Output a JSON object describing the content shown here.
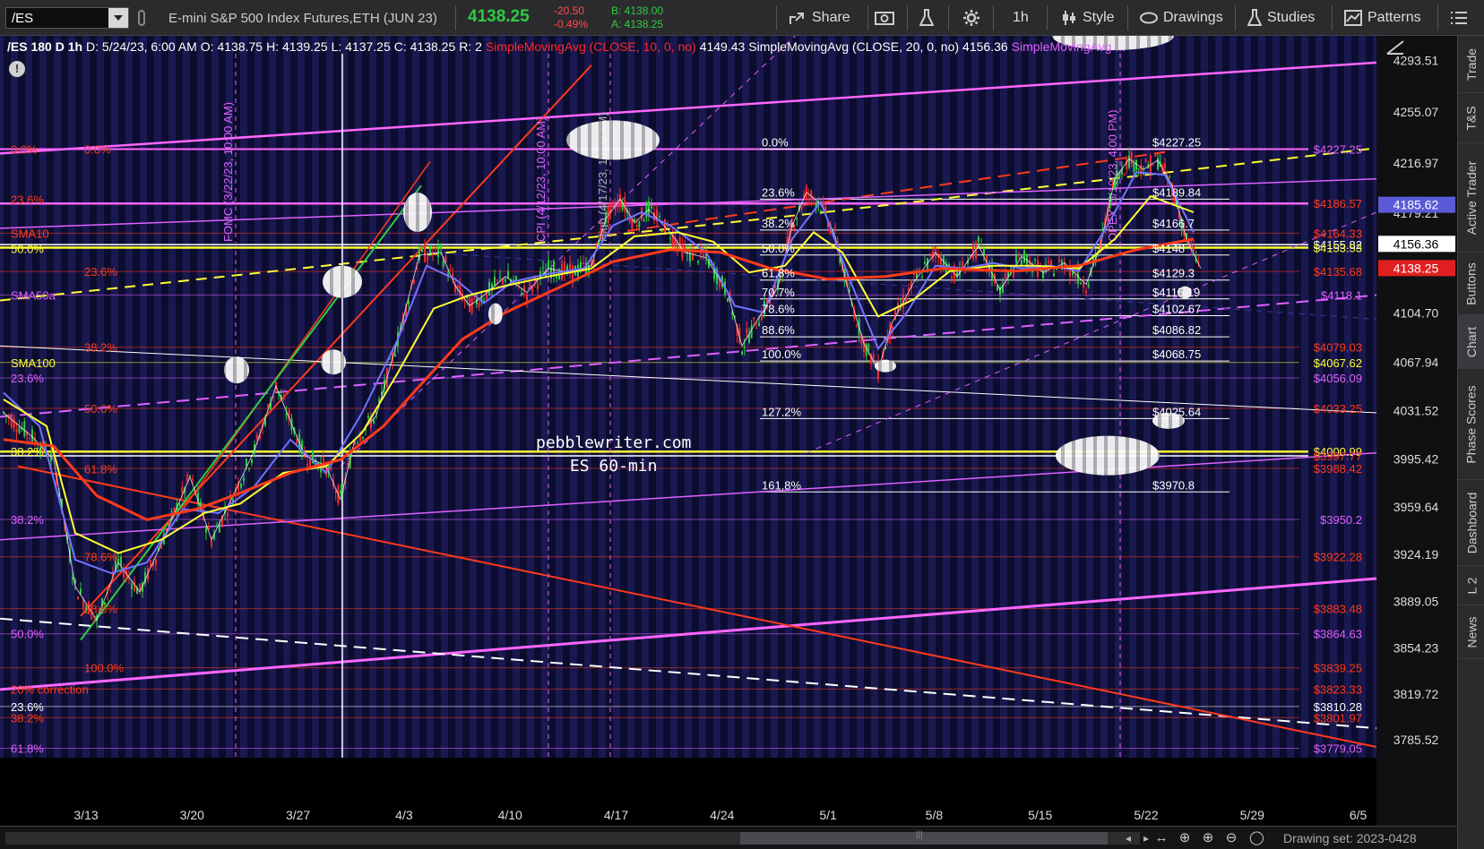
{
  "toolbar": {
    "symbol": "/ES",
    "instrument": "E-mini S&P 500 Index Futures,ETH (JUN 23)",
    "last": "4138.25",
    "net_change": "-20.50",
    "pct_change": "-0.49%",
    "bid": "B: 4138.00",
    "ask": "A: 4138.25",
    "share": "Share",
    "interval": "1h",
    "style": "Style",
    "drawings": "Drawings",
    "studies": "Studies",
    "patterns": "Patterns"
  },
  "stats_bar": {
    "symbol": "/ES 180 D 1h",
    "date": "D: 5/24/23, 6:00 AM",
    "open": "O: 4138.75",
    "high": "H: 4139.25",
    "low": "L: 4137.25",
    "close": "C: 4138.25",
    "range": "R: 2",
    "sma10_label": "SimpleMovingAvg (CLOSE, 10, 0, no)",
    "sma10_value": "4149.43",
    "sma20_label": "SimpleMovingAvg (CLOSE, 20, 0, no)",
    "sma20_value": "4156.36",
    "sma_more": "SimpleMovingAvg ..."
  },
  "right_tabs": [
    "Trade",
    "T&S",
    "Active Trader",
    "Buttons",
    "Chart",
    "Phase Scores",
    "Dashboard",
    "L 2",
    "News"
  ],
  "active_tab": "Chart",
  "bottom_bar": {
    "drawing_set": "Drawing set: 2023-0428"
  },
  "watermark": {
    "line1": "pebblewriter.com",
    "line2": "ES 60-min"
  },
  "chart_data": {
    "type": "candlestick",
    "x_ticks": [
      "3/13",
      "3/20",
      "3/27",
      "4/3",
      "4/10",
      "4/17",
      "4/24",
      "5/1",
      "5/8",
      "5/15",
      "5/22",
      "5/29",
      "6/5"
    ],
    "y_ticks": [
      4293.51,
      4255.07,
      4216.97,
      4179.21,
      4104.7,
      4067.94,
      4031.52,
      3995.42,
      3959.64,
      3924.19,
      3889.05,
      3854.23,
      3819.72,
      3785.52
    ],
    "ylim": [
      3772,
      4312
    ],
    "price_badges": [
      {
        "value": "4185.62",
        "color": "#5b5bd8"
      },
      {
        "value": "4156.36",
        "color": "#ffffff"
      },
      {
        "value": "4138.25",
        "color": "#e02020"
      }
    ],
    "series": [
      {
        "name": "SMA10",
        "color": "#6f73ff"
      },
      {
        "name": "SMA20",
        "color": "#ffff33"
      },
      {
        "name": "SMA50a",
        "color": "#ff3a1a"
      },
      {
        "name": "SMA100",
        "color": "#ff3a1a"
      }
    ],
    "price_path": [
      [
        0,
        4030
      ],
      [
        8,
        4012
      ],
      [
        14,
        3995
      ],
      [
        20,
        3900
      ],
      [
        26,
        3875
      ],
      [
        32,
        3918
      ],
      [
        38,
        3896
      ],
      [
        44,
        3932
      ],
      [
        52,
        3982
      ],
      [
        58,
        3935
      ],
      [
        64,
        3968
      ],
      [
        70,
        4002
      ],
      [
        76,
        4050
      ],
      [
        84,
        3998
      ],
      [
        90,
        3990
      ],
      [
        94,
        3965
      ],
      [
        98,
        4010
      ],
      [
        104,
        4028
      ],
      [
        110,
        4085
      ],
      [
        116,
        4148
      ],
      [
        122,
        4150
      ],
      [
        126,
        4125
      ],
      [
        130,
        4110
      ],
      [
        134,
        4118
      ],
      [
        140,
        4132
      ],
      [
        146,
        4120
      ],
      [
        152,
        4138
      ],
      [
        158,
        4135
      ],
      [
        164,
        4140
      ],
      [
        168,
        4175
      ],
      [
        172,
        4190
      ],
      [
        176,
        4172
      ],
      [
        180,
        4182
      ],
      [
        186,
        4165
      ],
      [
        190,
        4150
      ],
      [
        196,
        4146
      ],
      [
        202,
        4120
      ],
      [
        206,
        4080
      ],
      [
        210,
        4098
      ],
      [
        216,
        4124
      ],
      [
        220,
        4170
      ],
      [
        224,
        4195
      ],
      [
        228,
        4186
      ],
      [
        232,
        4162
      ],
      [
        236,
        4118
      ],
      [
        240,
        4082
      ],
      [
        244,
        4062
      ],
      [
        248,
        4098
      ],
      [
        254,
        4128
      ],
      [
        260,
        4150
      ],
      [
        266,
        4132
      ],
      [
        272,
        4155
      ],
      [
        278,
        4122
      ],
      [
        284,
        4147
      ],
      [
        290,
        4135
      ],
      [
        296,
        4142
      ],
      [
        302,
        4126
      ],
      [
        306,
        4155
      ],
      [
        310,
        4205
      ],
      [
        314,
        4220
      ],
      [
        318,
        4212
      ],
      [
        322,
        4219
      ],
      [
        326,
        4200
      ],
      [
        330,
        4160
      ],
      [
        334,
        4138
      ]
    ],
    "sma_fast_path": [
      [
        0,
        4045
      ],
      [
        10,
        4020
      ],
      [
        20,
        3920
      ],
      [
        30,
        3910
      ],
      [
        40,
        3918
      ],
      [
        50,
        3958
      ],
      [
        60,
        3955
      ],
      [
        70,
        3975
      ],
      [
        80,
        4010
      ],
      [
        90,
        3985
      ],
      [
        100,
        4030
      ],
      [
        110,
        4085
      ],
      [
        118,
        4140
      ],
      [
        126,
        4130
      ],
      [
        134,
        4112
      ],
      [
        142,
        4128
      ],
      [
        152,
        4134
      ],
      [
        162,
        4138
      ],
      [
        170,
        4170
      ],
      [
        178,
        4180
      ],
      [
        186,
        4170
      ],
      [
        196,
        4150
      ],
      [
        204,
        4110
      ],
      [
        212,
        4105
      ],
      [
        220,
        4160
      ],
      [
        228,
        4188
      ],
      [
        236,
        4130
      ],
      [
        244,
        4078
      ],
      [
        252,
        4105
      ],
      [
        260,
        4140
      ],
      [
        268,
        4138
      ],
      [
        276,
        4142
      ],
      [
        284,
        4138
      ],
      [
        292,
        4140
      ],
      [
        300,
        4136
      ],
      [
        308,
        4170
      ],
      [
        316,
        4210
      ],
      [
        324,
        4208
      ],
      [
        332,
        4165
      ]
    ],
    "sma_slow_path": [
      [
        0,
        4040
      ],
      [
        12,
        4020
      ],
      [
        20,
        3940
      ],
      [
        32,
        3925
      ],
      [
        44,
        3935
      ],
      [
        56,
        3955
      ],
      [
        66,
        3962
      ],
      [
        78,
        3985
      ],
      [
        90,
        3990
      ],
      [
        100,
        4015
      ],
      [
        110,
        4060
      ],
      [
        120,
        4108
      ],
      [
        130,
        4118
      ],
      [
        140,
        4125
      ],
      [
        152,
        4132
      ],
      [
        164,
        4138
      ],
      [
        176,
        4162
      ],
      [
        188,
        4165
      ],
      [
        198,
        4158
      ],
      [
        208,
        4135
      ],
      [
        218,
        4140
      ],
      [
        226,
        4165
      ],
      [
        234,
        4150
      ],
      [
        244,
        4102
      ],
      [
        254,
        4115
      ],
      [
        264,
        4136
      ],
      [
        276,
        4140
      ],
      [
        288,
        4140
      ],
      [
        300,
        4138
      ],
      [
        310,
        4160
      ],
      [
        320,
        4192
      ],
      [
        332,
        4180
      ]
    ],
    "sma50_path": [
      [
        0,
        4010
      ],
      [
        14,
        4005
      ],
      [
        26,
        3968
      ],
      [
        40,
        3950
      ],
      [
        54,
        3958
      ],
      [
        66,
        3970
      ],
      [
        80,
        3985
      ],
      [
        94,
        3995
      ],
      [
        106,
        4020
      ],
      [
        116,
        4050
      ],
      [
        128,
        4085
      ],
      [
        140,
        4105
      ],
      [
        156,
        4125
      ],
      [
        170,
        4143
      ],
      [
        186,
        4152
      ],
      [
        200,
        4150
      ],
      [
        214,
        4138
      ],
      [
        230,
        4130
      ],
      [
        246,
        4132
      ],
      [
        262,
        4138
      ],
      [
        282,
        4136
      ],
      [
        300,
        4140
      ],
      [
        316,
        4152
      ],
      [
        332,
        4160
      ]
    ],
    "fib_left_labels": [
      {
        "text": "0.0%",
        "price": 4227.25,
        "color": "#ff3a1a",
        "x": 12
      },
      {
        "text": "0.0%",
        "price": 4227.25,
        "color": "#ff3a1a",
        "x": 94
      },
      {
        "text": "23.6%",
        "price": 4189.84,
        "color": "#ff3a1a",
        "x": 12
      },
      {
        "text": "SMA10",
        "price": 4164.33,
        "color": "#ff3a1a",
        "x": 12
      },
      {
        "text": "50.0%",
        "price": 4152.9,
        "color": "#ffff33",
        "x": 12
      },
      {
        "text": "23.6%",
        "price": 4135.68,
        "color": "#ff3a1a",
        "x": 94
      },
      {
        "text": "SMA50a",
        "price": 4118.1,
        "color": "#e060ff",
        "x": 12
      },
      {
        "text": "38.2%",
        "price": 4079.03,
        "color": "#ff3a1a",
        "x": 94
      },
      {
        "text": "SMA100",
        "price": 4067.62,
        "color": "#ffff33",
        "x": 12
      },
      {
        "text": "23.6%",
        "price": 4056.09,
        "color": "#e060ff",
        "x": 12
      },
      {
        "text": "50.0%",
        "price": 4033.25,
        "color": "#ff3a1a",
        "x": 94
      },
      {
        "text": "38.2%",
        "price": 4000.99,
        "color": "#ffff33",
        "x": 12
      },
      {
        "text": "61.8%",
        "price": 3988.0,
        "color": "#ff3a1a",
        "x": 94
      },
      {
        "text": "38.2%",
        "price": 3950.2,
        "color": "#e060ff",
        "x": 12
      },
      {
        "text": "78.6%",
        "price": 3922.28,
        "color": "#ff3a1a",
        "x": 94
      },
      {
        "text": "88.6%",
        "price": 3883.48,
        "color": "#ff3a1a",
        "x": 94
      },
      {
        "text": "50.0%",
        "price": 3864.63,
        "color": "#e060ff",
        "x": 12
      },
      {
        "text": "100.0%",
        "price": 3839.25,
        "color": "#ff3a1a",
        "x": 94
      },
      {
        "text": "20% correction",
        "price": 3823.33,
        "color": "#ff3a1a",
        "x": 12
      },
      {
        "text": "23.6%",
        "price": 3810.28,
        "color": "#ffffff",
        "x": 12
      },
      {
        "text": "38.2%",
        "price": 3801.97,
        "color": "#ff3a1a",
        "x": 12
      },
      {
        "text": "61.8%",
        "price": 3779.05,
        "color": "#e060ff",
        "x": 12
      }
    ],
    "fib_mid_labels": [
      {
        "pct": "0.0%",
        "price": 4227.25
      },
      {
        "pct": "23.6%",
        "price": 4189.84
      },
      {
        "pct": "38.2%",
        "price": 4166.7
      },
      {
        "pct": "50.0%",
        "price": 4148
      },
      {
        "pct": "61.8%",
        "price": 4129.3
      },
      {
        "pct": "70.7%",
        "price": 4115.19
      },
      {
        "pct": "78.6%",
        "price": 4102.67
      },
      {
        "pct": "88.6%",
        "price": 4086.82
      },
      {
        "pct": "100.0%",
        "price": 4068.75
      },
      {
        "pct": "127.2%",
        "price": 4025.64
      },
      {
        "pct": "161.8%",
        "price": 3970.8
      }
    ],
    "fib_mid_values": [
      "$4227.25",
      "$4189.84",
      "$4166.7",
      "$4148",
      "$4129.3",
      "$4115.19",
      "$4102.67",
      "$4086.82",
      "$4068.75",
      "$4025.64",
      "$3970.8"
    ],
    "right_level_labels": [
      {
        "text": "$4227.25",
        "price": 4227.25,
        "color": "#e060ff"
      },
      {
        "text": "$4186.57",
        "price": 4186.57,
        "color": "#ff3a1a"
      },
      {
        "text": "$4164.33",
        "price": 4164.33,
        "color": "#ff3a1a"
      },
      {
        "text": "$4155.82",
        "price": 4155.82,
        "color": "#ffffff"
      },
      {
        "text": "$4153.53",
        "price": 4153.53,
        "color": "#ffff33"
      },
      {
        "text": "$4135.68",
        "price": 4135.68,
        "color": "#ff3a1a"
      },
      {
        "text": "$4118.1",
        "price": 4118.1,
        "color": "#e060ff"
      },
      {
        "text": "$4079.03",
        "price": 4079.03,
        "color": "#ff3a1a"
      },
      {
        "text": "$4067.62",
        "price": 4067.62,
        "color": "#ffff33"
      },
      {
        "text": "$4056.09",
        "price": 4056.09,
        "color": "#e060ff"
      },
      {
        "text": "$4033.25",
        "price": 4033.25,
        "color": "#ff3a1a"
      },
      {
        "text": "$4000.99",
        "price": 4000.99,
        "color": "#ffff33"
      },
      {
        "text": "$3997.77",
        "price": 3997.77,
        "color": "#ff3a1a"
      },
      {
        "text": "$3988.42",
        "price": 3988.42,
        "color": "#ff3a1a"
      },
      {
        "text": "$3950.2",
        "price": 3950.2,
        "color": "#e060ff"
      },
      {
        "text": "$3922.28",
        "price": 3922.28,
        "color": "#ff3a1a"
      },
      {
        "text": "$3883.48",
        "price": 3883.48,
        "color": "#ff3a1a"
      },
      {
        "text": "$3864.63",
        "price": 3864.63,
        "color": "#e060ff"
      },
      {
        "text": "$3839.25",
        "price": 3839.25,
        "color": "#ff3a1a"
      },
      {
        "text": "$3823.33",
        "price": 3823.33,
        "color": "#ff3a1a"
      },
      {
        "text": "$3810.28",
        "price": 3810.28,
        "color": "#ffffff"
      },
      {
        "text": "$3801.97",
        "price": 3801.97,
        "color": "#ff3a1a"
      },
      {
        "text": "$3779.05",
        "price": 3779.05,
        "color": "#e060ff"
      }
    ],
    "event_lines": [
      {
        "text": "FOMC (3/22/23, 10:00 AM)",
        "x_day": 9.5
      },
      {
        "text": "CPI (4/12/23, 10:00 AM)",
        "x_day": 30.5
      },
      {
        "text": "High (4/17/23, 10:00 AM)",
        "x_day": 35
      },
      {
        "text": "OPEX (5/19/23, 4:00 PM)",
        "x_day": 67
      }
    ],
    "grid": true,
    "legend": "none"
  }
}
